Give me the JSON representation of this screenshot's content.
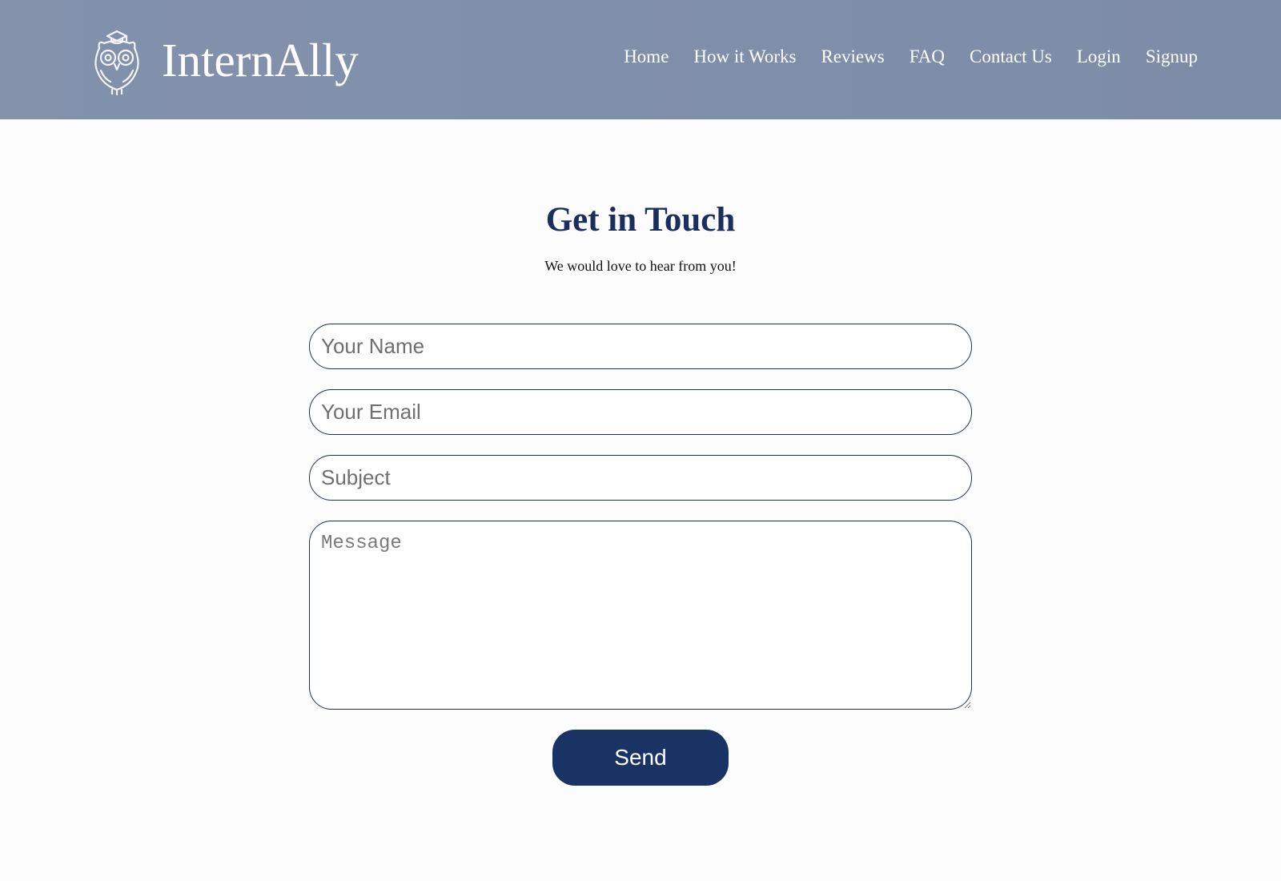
{
  "header": {
    "logo_icon": "owl-graduation-cap-icon",
    "brand": "InternAlly",
    "nav": [
      {
        "label": "Home"
      },
      {
        "label": "How it Works"
      },
      {
        "label": "Reviews"
      },
      {
        "label": "FAQ"
      },
      {
        "label": "Contact Us"
      },
      {
        "label": "Login"
      },
      {
        "label": "Signup"
      }
    ]
  },
  "contact": {
    "title": "Get in Touch",
    "subtitle": "We would love to hear from you!",
    "fields": {
      "name": {
        "placeholder": "Your Name",
        "value": ""
      },
      "email": {
        "placeholder": "Your Email",
        "value": ""
      },
      "subject": {
        "placeholder": "Subject",
        "value": ""
      },
      "message": {
        "placeholder": "Message",
        "value": ""
      }
    },
    "send_label": "Send"
  },
  "colors": {
    "header_bg": "#8190ab",
    "brand_navy": "#1b2f5f",
    "button_bg": "#183364",
    "page_bg": "#fcfcfc"
  }
}
